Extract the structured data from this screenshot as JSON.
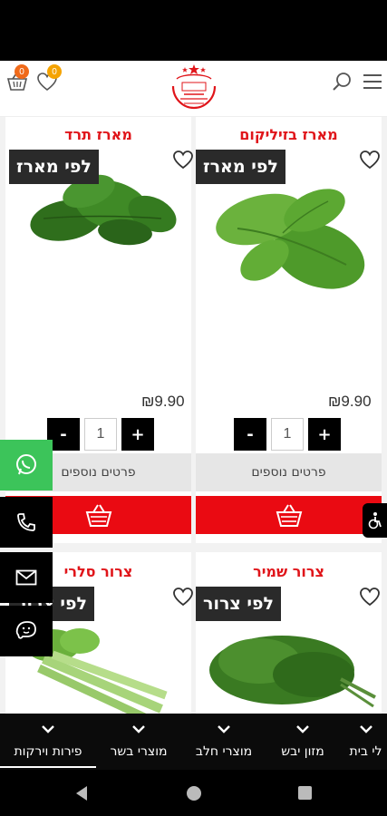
{
  "header": {
    "menu_icon": "hamburger-menu-icon",
    "search_icon": "search-icon",
    "logo_name": "store-logo",
    "wishlist_count": "0",
    "cart_count": "0",
    "badge_colors": {
      "wishlist": "#f5a300",
      "cart": "#f06a1a"
    }
  },
  "products": [
    {
      "title": "מארז בזיליקום",
      "unit_tag": "לפי מארז",
      "price": "₪9.90",
      "quantity": "1",
      "minus_label": "-",
      "plus_label": "+",
      "more_label": "פרטים נוספים"
    },
    {
      "title": "מארז תרד",
      "unit_tag": "לפי מארז",
      "price": "₪9.90",
      "quantity": "1",
      "minus_label": "-",
      "plus_label": "+",
      "more_label": "פרטים נוספים"
    },
    {
      "title": "צרור שמיר",
      "unit_tag": "לפי צרור"
    },
    {
      "title": "צרור סלרי",
      "unit_tag": "לפי צרור"
    }
  ],
  "floating_contacts": [
    "whatsapp-icon",
    "phone-icon",
    "email-icon",
    "waze-icon"
  ],
  "accessibility_icon": "accessibility-icon",
  "bottom_nav": [
    {
      "label": "פירות וירקות",
      "active": true
    },
    {
      "label": "מוצרי בשר"
    },
    {
      "label": "מוצרי חלב"
    },
    {
      "label": "מזון יבש"
    },
    {
      "label": "לי בית"
    }
  ],
  "colors": {
    "accent_red": "#e0151a",
    "cart_red": "#ea0a12",
    "tag_dark": "#2a2a2a",
    "whatsapp_green": "#3cc45a"
  }
}
